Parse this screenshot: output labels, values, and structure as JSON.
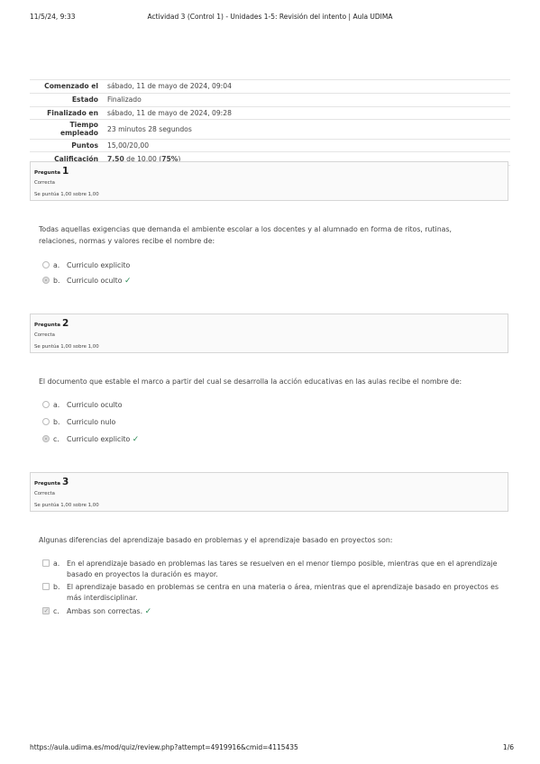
{
  "header": {
    "datetime": "11/5/24, 9:33",
    "title": "Actividad 3 (Control 1) - Unidades 1-5: Revisión del intento | Aula UDIMA"
  },
  "summary": {
    "started_label": "Comenzado el",
    "started_value": "sábado, 11 de mayo de 2024, 09:04",
    "state_label": "Estado",
    "state_value": "Finalizado",
    "finished_label": "Finalizado en",
    "finished_value": "sábado, 11 de mayo de 2024, 09:28",
    "time_label": "Tiempo empleado",
    "time_value": "23 minutos 28 segundos",
    "points_label": "Puntos",
    "points_value": "15,00/20,00",
    "grade_label": "Calificación",
    "grade_score": "7,50",
    "grade_mid": " de 10,00 (",
    "grade_percent": "75%",
    "grade_end": ")"
  },
  "questions": [
    {
      "label": "Pregunta",
      "number": "1",
      "state": "Correcta",
      "grade": "Se puntúa 1,00 sobre 1,00",
      "text": "Todas aquellas exigencias que demanda el ambiente escolar a los docentes y al alumnado en forma de ritos, rutinas, relaciones, normas y valores recibe el nombre de:",
      "options": [
        {
          "letter": "a.",
          "text": "Curriculo explicito",
          "selected": false
        },
        {
          "letter": "b.",
          "text": "Curriculo oculto",
          "selected": true
        }
      ]
    },
    {
      "label": "Pregunta",
      "number": "2",
      "state": "Correcta",
      "grade": "Se puntúa 1,00 sobre 1,00",
      "text": "El documento que estable el marco a partir del cual se desarrolla la acción educativas en las aulas recibe el nombre de:",
      "options": [
        {
          "letter": "a.",
          "text": "Curriculo oculto",
          "selected": false
        },
        {
          "letter": "b.",
          "text": "Curriculo nulo",
          "selected": false
        },
        {
          "letter": "c.",
          "text": "Curriculo explicito",
          "selected": true
        }
      ]
    },
    {
      "label": "Pregunta",
      "number": "3",
      "state": "Correcta",
      "grade": "Se puntúa 1,00 sobre 1,00",
      "text": "Algunas diferencias del aprendizaje basado en problemas y el aprendizaje basado en proyectos son:",
      "options": [
        {
          "letter": "a.",
          "text": "En el aprendizaje basado en problemas las tares se resuelven en el menor tiempo posible, mientras que en el aprendizaje basado en proyectos la duración es mayor.",
          "selected": false
        },
        {
          "letter": "b.",
          "text": "El aprendizaje basado en problemas se centra en una materia o área, mientras que el aprendizaje basado en proyectos es más interdisciplinar.",
          "selected": false
        },
        {
          "letter": "c.",
          "text": "Ambas son correctas.",
          "selected": true
        }
      ]
    }
  ],
  "correct_mark": "✓",
  "footer": {
    "url": "https://aula.udima.es/mod/quiz/review.php?attempt=4919916&cmid=4115435",
    "page": "1/6"
  }
}
